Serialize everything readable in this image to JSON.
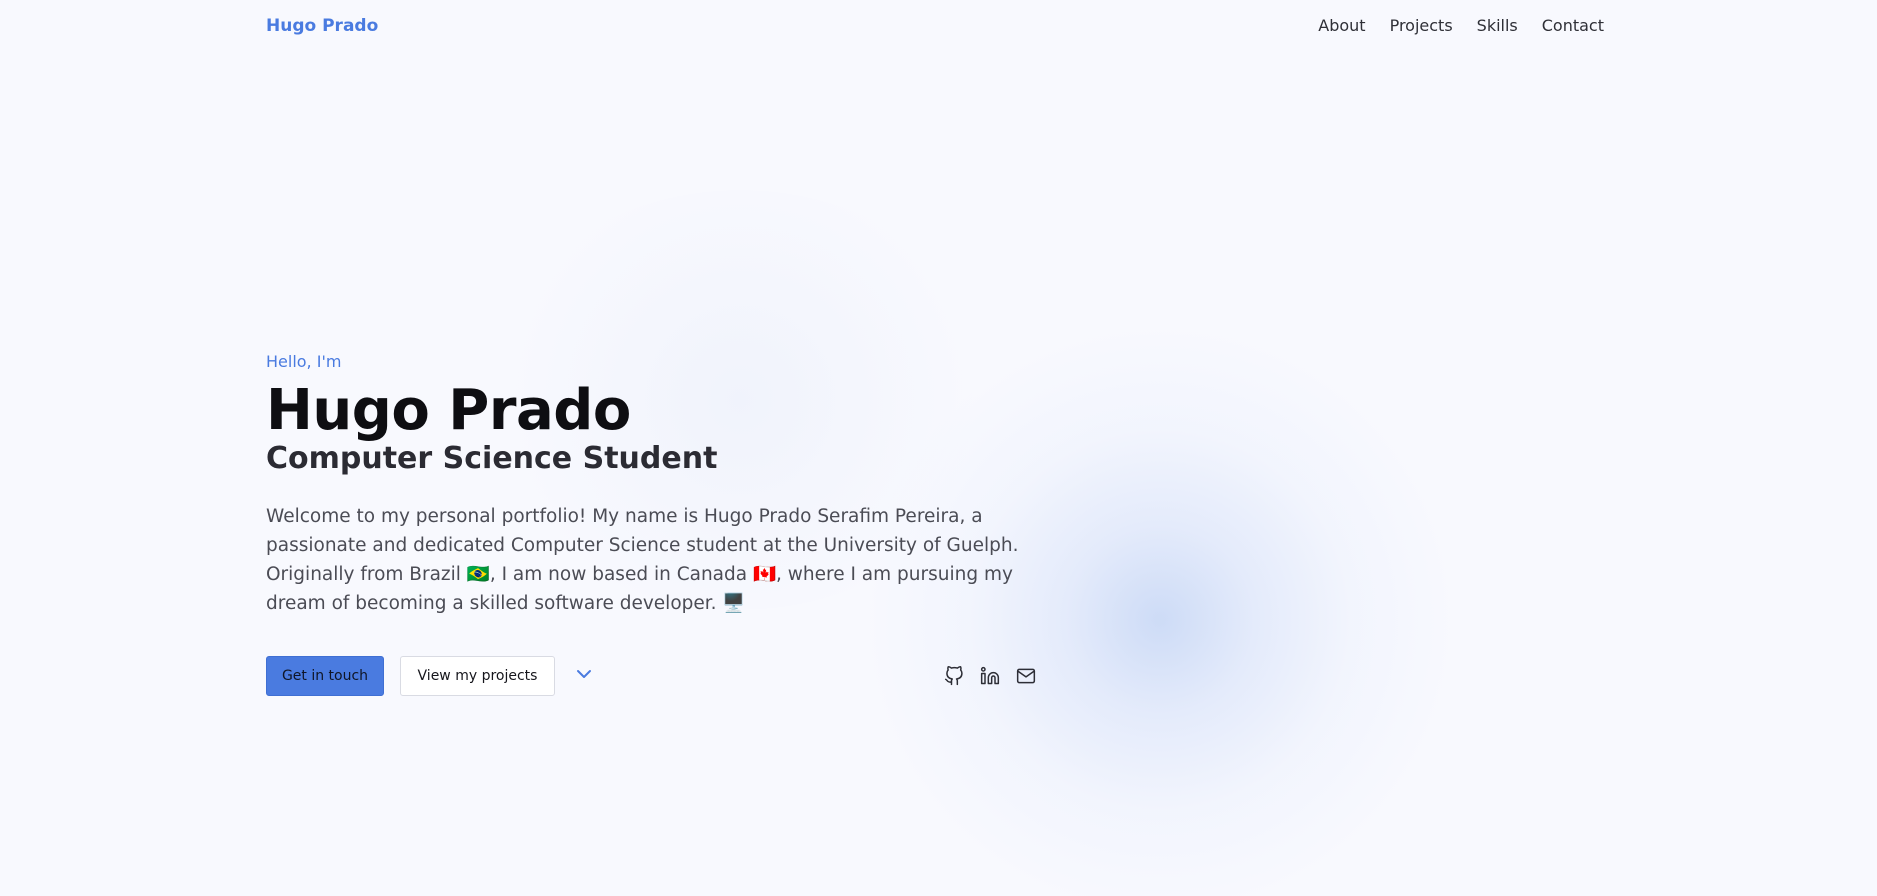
{
  "nav": {
    "brand": "Hugo Prado",
    "links": [
      {
        "label": "About"
      },
      {
        "label": "Projects"
      },
      {
        "label": "Skills"
      },
      {
        "label": "Contact"
      }
    ]
  },
  "hero": {
    "greeting": "Hello, I'm",
    "name": "Hugo Prado",
    "role": "Computer Science Student",
    "intro": "Welcome to my personal portfolio! My name is Hugo Prado Serafim Pereira, a passionate and dedicated Computer Science student at the University of Guelph. Originally from Brazil 🇧🇷, I am now based in Canada 🇨🇦, where I am pursuing my dream of becoming a skilled software developer. 🖥️"
  },
  "actions": {
    "primary_label": "Get in touch",
    "secondary_label": "View my projects",
    "scroll_icon": "chevron-down-icon"
  },
  "socials": [
    {
      "icon": "github-icon"
    },
    {
      "icon": "linkedin-icon"
    },
    {
      "icon": "mail-icon"
    }
  ],
  "colors": {
    "accent": "#4a7be0",
    "background": "#f8f9fe",
    "heading": "#0e0e12"
  }
}
